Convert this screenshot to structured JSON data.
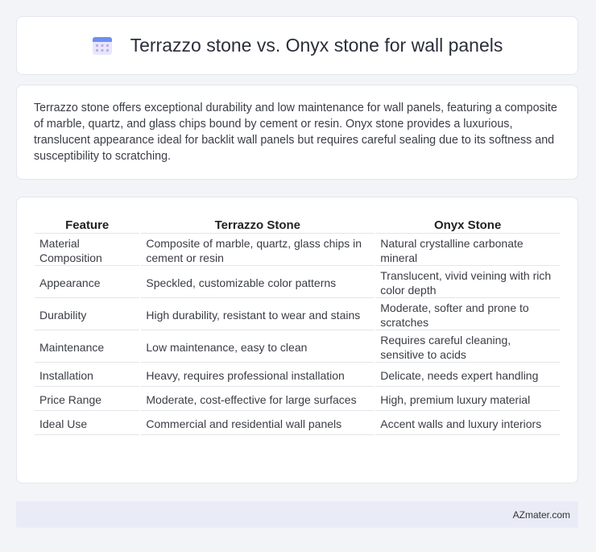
{
  "header": {
    "title": "Terrazzo stone vs. Onyx stone for wall panels",
    "icon": "calendar-icon"
  },
  "summary": {
    "text": "Terrazzo stone offers exceptional durability and low maintenance for wall panels, featuring a composite of marble, quartz, and glass chips bound by cement or resin. Onyx stone provides a luxurious, translucent appearance ideal for backlit wall panels but requires careful sealing due to its softness and susceptibility to scratching."
  },
  "table": {
    "headers": [
      "Feature",
      "Terrazzo Stone",
      "Onyx Stone"
    ],
    "rows": [
      [
        "Material Composition",
        "Composite of marble, quartz, glass chips in cement or resin",
        "Natural crystalline carbonate mineral"
      ],
      [
        "Appearance",
        "Speckled, customizable color patterns",
        "Translucent, vivid veining with rich color depth"
      ],
      [
        "Durability",
        "High durability, resistant to wear and stains",
        "Moderate, softer and prone to scratches"
      ],
      [
        "Maintenance",
        "Low maintenance, easy to clean",
        "Requires careful cleaning, sensitive to acids"
      ],
      [
        "Installation",
        "Heavy, requires professional installation",
        "Delicate, needs expert handling"
      ],
      [
        "Price Range",
        "Moderate, cost-effective for large surfaces",
        "High, premium luxury material"
      ],
      [
        "Ideal Use",
        "Commercial and residential wall panels",
        "Accent walls and luxury interiors"
      ]
    ]
  },
  "footer": {
    "brand": "AZmater.com"
  }
}
